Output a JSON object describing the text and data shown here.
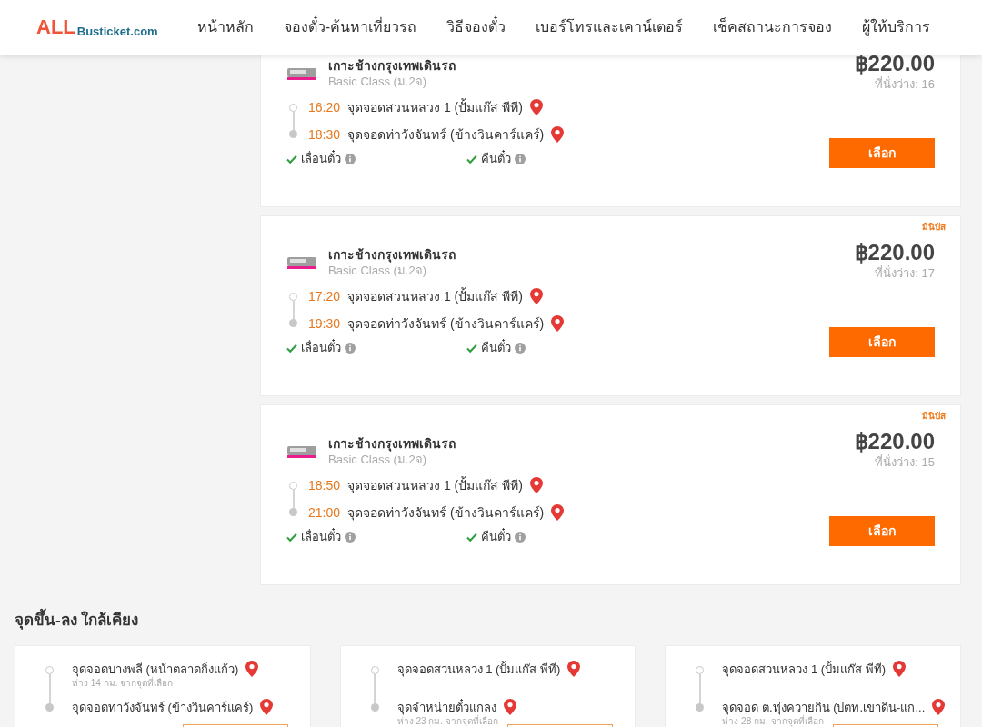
{
  "header": {
    "logo_primary": "ALL",
    "logo_secondary": "Busticket.com",
    "nav": [
      "หน้าหลัก",
      "จองตั๋ว-ค้นหาเที่ยวรถ",
      "วิธีจองตั๋ว",
      "เบอร์โทรและเคาน์เตอร์",
      "เช็คสถานะการจอง",
      "ผู้ให้บริการ"
    ]
  },
  "trips": [
    {
      "operator": "เกาะช้างกรุงเทพเดินรถ",
      "class": "Basic Class (ม.2จ)",
      "price": "฿220.00",
      "seats": "ที่นั่งว่าง: 16",
      "stops": [
        {
          "time": "16:20",
          "name": "จุดจอดสวนหลวง 1 (ปั้มแก๊ส พีที)"
        },
        {
          "time": "18:30",
          "name": "จุดจอดท่าวังจันทร์ (ข้างวินคาร์แคร์)"
        }
      ],
      "features": [
        {
          "label": "เลื่อนตั๋ว",
          "checked": true
        },
        {
          "label": "คืนตั๋ว",
          "checked": true
        }
      ],
      "button": "เลือก"
    },
    {
      "badge": "มินิบัส",
      "operator": "เกาะช้างกรุงเทพเดินรถ",
      "class": "Basic Class (ม.2จ)",
      "price": "฿220.00",
      "seats": "ที่นั่งว่าง: 17",
      "stops": [
        {
          "time": "17:20",
          "name": "จุดจอดสวนหลวง 1 (ปั้มแก๊ส พีที)"
        },
        {
          "time": "19:30",
          "name": "จุดจอดท่าวังจันทร์ (ข้างวินคาร์แคร์)"
        }
      ],
      "features": [
        {
          "label": "เลื่อนตั๋ว",
          "checked": true
        },
        {
          "label": "คืนตั๋ว",
          "checked": true
        }
      ],
      "button": "เลือก"
    },
    {
      "badge": "มินิบัส",
      "operator": "เกาะช้างกรุงเทพเดินรถ",
      "class": "Basic Class (ม.2จ)",
      "price": "฿220.00",
      "seats": "ที่นั่งว่าง: 15",
      "stops": [
        {
          "time": "18:50",
          "name": "จุดจอดสวนหลวง 1 (ปั้มแก๊ส พีที)"
        },
        {
          "time": "21:00",
          "name": "จุดจอดท่าวังจันทร์ (ข้างวินคาร์แคร์)"
        }
      ],
      "features": [
        {
          "label": "เลื่อนตั๋ว",
          "checked": true
        },
        {
          "label": "คืนตั๋ว",
          "checked": true
        }
      ],
      "button": "เลือก"
    }
  ],
  "nearby": {
    "title": "จุดขึ้น-ลง ใกล้เคียง",
    "cards": [
      {
        "stops": [
          {
            "name": "จุดจอดบางพลี (หน้าตลาดกิ่งแก้ว)",
            "distance": "ห่าง 14 กม. จากจุดที่เลือก"
          },
          {
            "name": "จุดจอดท่าวังจันทร์ (ข้างวินคาร์แคร์)"
          }
        ]
      },
      {
        "stops": [
          {
            "name": "จุดจอดสวนหลวง 1 (ปั้มแก๊ส พีที)"
          },
          {
            "name": "จุดจำหน่ายตั๋วแกลง",
            "distance": "ห่าง 23 กม. จากจุดที่เลือก"
          }
        ]
      },
      {
        "stops": [
          {
            "name": "จุดจอดสวนหลวง 1 (ปั้มแก๊ส พีที)"
          },
          {
            "name": "จุดจอด ต.ทุ่งควายกิน (ปตท.เขาดิน-แก...",
            "distance": "ห่าง 28 กม. จากจุดที่เลือก"
          }
        ]
      }
    ]
  }
}
